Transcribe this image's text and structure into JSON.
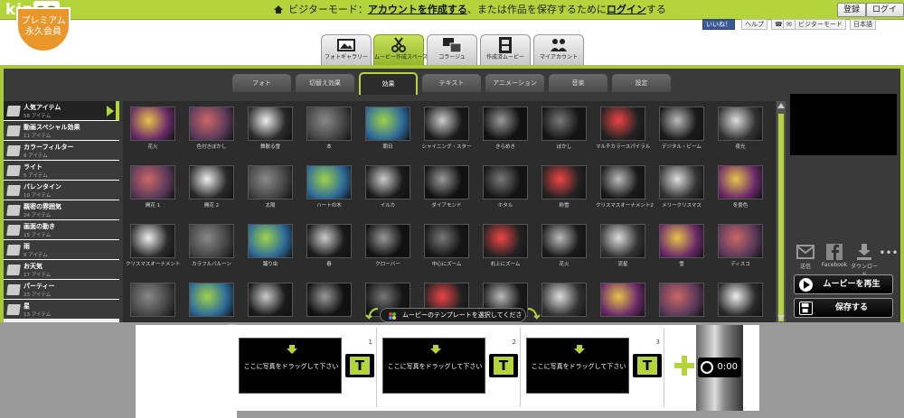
{
  "topbar": {
    "logo": "kiz",
    "logo_tail": "oa",
    "badge_line1": "プレミアム",
    "badge_line2": "永久会員",
    "message_prefix": "ビジターモード：",
    "message_link1": "アカウントを作成する",
    "message_mid": "、または作品を保存するために",
    "message_link2": "ログイン",
    "message_suffix": "する",
    "register_label": "登録",
    "login_label": "ログイン"
  },
  "header": {
    "like_label": "いいね！",
    "help_label": "ヘルプ",
    "mode_label": "ビジターモード",
    "language_label": "日本語",
    "main_tabs": [
      {
        "label": "フォトギャラリー"
      },
      {
        "label": "ムービー作成スペース"
      },
      {
        "label": "コラージュ"
      },
      {
        "label": "作成済ムービー"
      },
      {
        "label": "マイアカウント"
      }
    ]
  },
  "subtabs": [
    {
      "label": "フォト"
    },
    {
      "label": "切替え効果"
    },
    {
      "label": "効果"
    },
    {
      "label": "テキスト"
    },
    {
      "label": "アニメーション"
    },
    {
      "label": "音楽"
    },
    {
      "label": "設定"
    }
  ],
  "categories": [
    {
      "name": "人気アイテム",
      "count": "58 アイテム"
    },
    {
      "name": "動画スペシャル効果",
      "count": "11 アイテム"
    },
    {
      "name": "カラーフィルター",
      "count": "8 アイテム"
    },
    {
      "name": "ライト",
      "count": "5 アイテム"
    },
    {
      "name": "バレンタイン",
      "count": "10 アイテム"
    },
    {
      "name": "親密の雰囲気",
      "count": "24 アイテム"
    },
    {
      "name": "画面の動き",
      "count": "15 アイテム"
    },
    {
      "name": "雨",
      "count": "9 アイテム"
    },
    {
      "name": "お天気",
      "count": "17 アイテム"
    },
    {
      "name": "パーティー",
      "count": "23 アイテム"
    },
    {
      "name": "星",
      "count": "13 アイテム"
    }
  ],
  "effects_rows": [
    [
      "花火",
      "色付きぼかし",
      "舞散る雪",
      "本",
      "朝日",
      "シャイニング・スター",
      "きらめき",
      "ぼかし",
      "マルチカラースパイラル",
      "デジタル・ビーム",
      "夜光"
    ],
    [
      "開花 1",
      "開花 2",
      "太陽",
      "ハートの木",
      "イルカ",
      "ダイアモンド",
      "ホタル",
      "粉雪",
      "クリスマスオーナメント2",
      "メリークリスマス",
      "冬景色"
    ],
    [
      "クリスマスオーナメント",
      "カラフルバルーン",
      "踊り虫",
      "春",
      "クローバー",
      "中心にズーム",
      "右上にズーム",
      "花火",
      "流星",
      "雪",
      "ディスコ"
    ],
    [
      "",
      "",
      "",
      "",
      "",
      "",
      "",
      "",
      "",
      "",
      ""
    ]
  ],
  "right_panel": {
    "share_items": [
      {
        "label": "送信",
        "icon": "mail-icon"
      },
      {
        "label": "Facebook",
        "icon": "facebook-icon"
      },
      {
        "label": "ダウンロード",
        "icon": "download-icon"
      }
    ],
    "play_label": "ムービーを再生",
    "save_label": "保存する"
  },
  "timeline": {
    "tip": "ムービーのテンプレートを選択してください",
    "slots": [
      {
        "num": "1",
        "text": "ここに写真をドラッグして下さい"
      },
      {
        "num": "2",
        "text": "ここに写真をドラッグして下さい"
      },
      {
        "num": "3",
        "text": "ここに写真をドラッグして下さい"
      }
    ],
    "text_button": "T",
    "duration": "0:00"
  },
  "colors": {
    "accent": "#b4d43c",
    "badge": "#e9962a",
    "facebook": "#3b5998"
  }
}
